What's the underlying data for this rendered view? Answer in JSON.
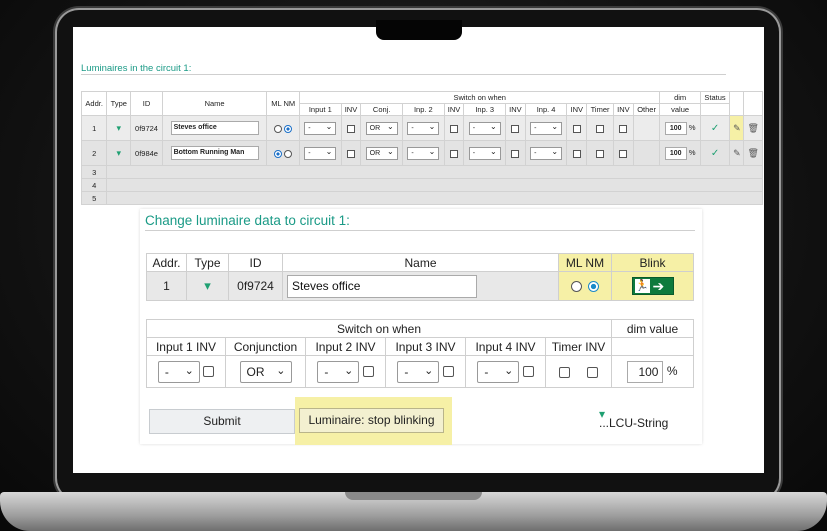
{
  "background_page": {
    "title": "Luminaires in the circuit 1:",
    "headers": {
      "addr": "Addr.",
      "type": "Type",
      "id": "ID",
      "name": "Name",
      "ml_nm": "ML NM",
      "switch_on_when": "Switch on when",
      "dim": "dim",
      "value": "value",
      "status": "Status",
      "input1": "Input 1",
      "inv": "INV",
      "conj": "Conj.",
      "input2": "Inp. 2",
      "input3": "Inp. 3",
      "input4": "Inp. 4",
      "timer": "Timer",
      "other": "Other"
    },
    "rows": [
      {
        "addr": "1",
        "id": "0f9724",
        "name": "Steves office",
        "input": "-",
        "conj": "OR",
        "dim": "100",
        "unit": "%"
      },
      {
        "addr": "2",
        "id": "0f984e",
        "name": "Bottom Running Man",
        "input": "-",
        "conj": "OR",
        "dim": "100",
        "unit": "%"
      }
    ],
    "empty_rows": [
      "3",
      "4",
      "5"
    ]
  },
  "dialog": {
    "title": "Change luminaire data to circuit 1:",
    "headers": {
      "addr": "Addr.",
      "type": "Type",
      "id": "ID",
      "name": "Name",
      "ml_nm": "ML NM",
      "blink": "Blink"
    },
    "luminaire": {
      "addr": "1",
      "id": "0f9724",
      "name": "Steves office",
      "mode": "NM"
    },
    "switch_header": "Switch on when",
    "dim_header": "dim value",
    "switch_columns": {
      "input1": "Input 1 INV",
      "conjunction": "Conjunction",
      "input2": "Input 2 INV",
      "input3": "Input 3 INV",
      "input4": "Input 4 INV",
      "timer": "Timer INV"
    },
    "values": {
      "input1": "-",
      "conjunction": "OR",
      "input2": "-",
      "input3": "-",
      "input4": "-",
      "dim": "100",
      "unit": "%"
    },
    "submit_label": "Submit",
    "stop_blink_label": "Luminaire: stop blinking",
    "lcu_label": "...LCU-String"
  },
  "colors": {
    "accent": "#1a9a86",
    "highlight": "#f6f0a6",
    "exit_green": "#0e7a3c"
  },
  "icons": [
    "luminaire-icon",
    "exit-sign-icon",
    "check-icon",
    "pencil-icon",
    "trash-icon",
    "chevron-down-icon"
  ]
}
